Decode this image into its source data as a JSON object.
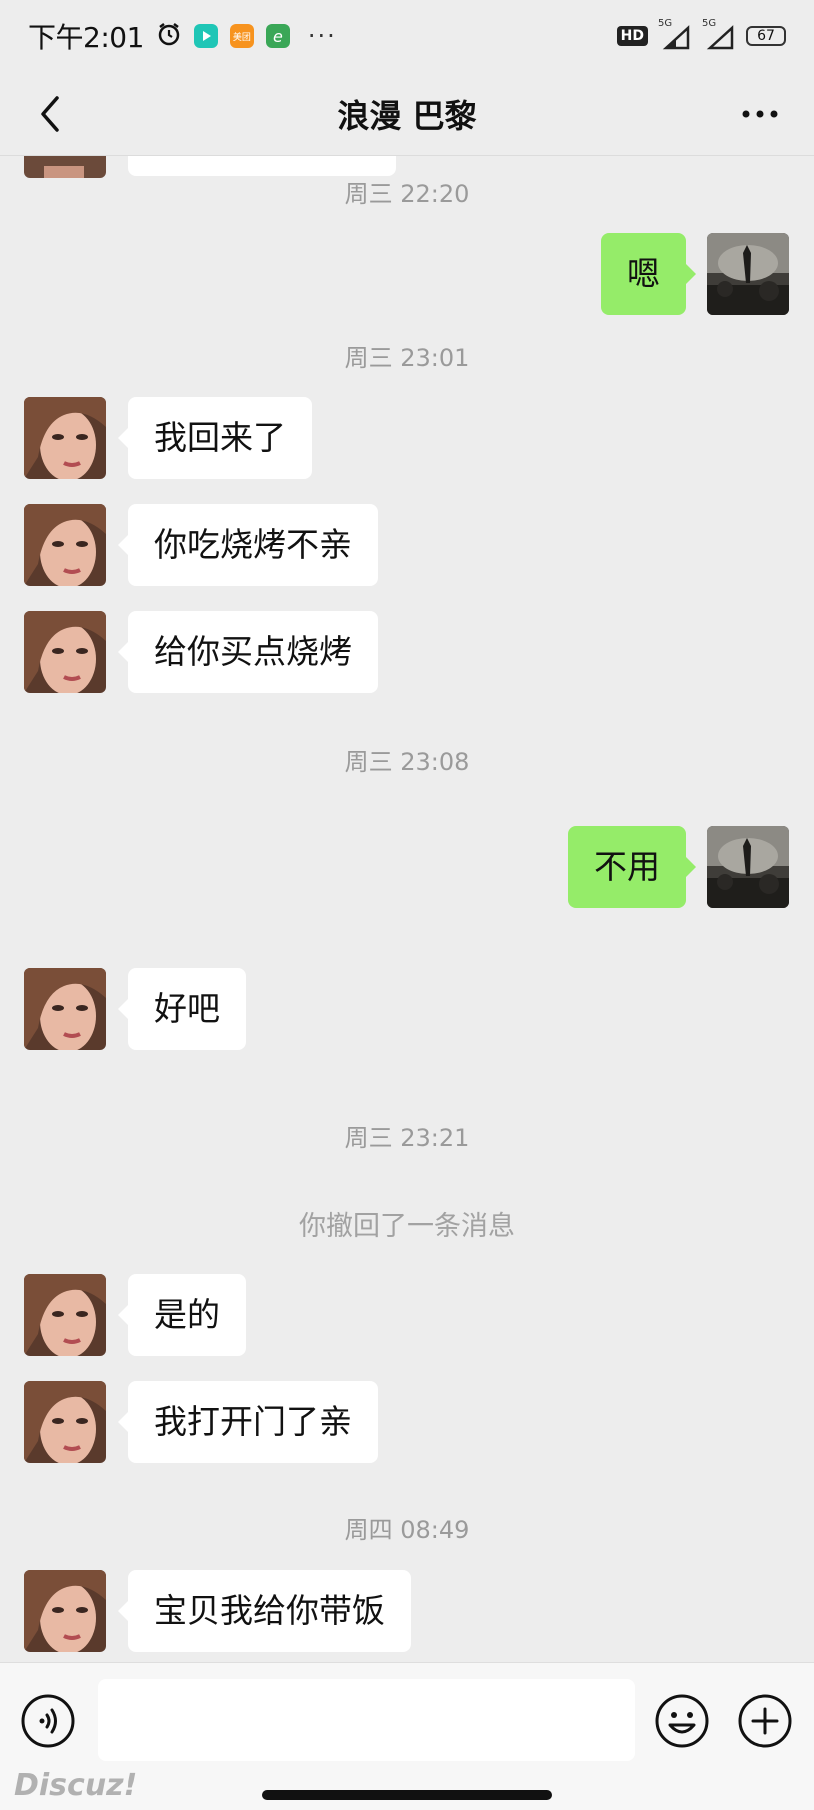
{
  "status_bar": {
    "time": "下午2:01",
    "app_icons": [
      {
        "name": "alarm-icon",
        "color": "#111111"
      },
      {
        "name": "video-app-icon",
        "color": "#1fc6b6"
      },
      {
        "name": "meituan-app-icon",
        "color": "#f7931e",
        "label": "美团"
      },
      {
        "name": "browser-app-icon",
        "color": "#3aa757",
        "label": "e"
      }
    ],
    "more": "···",
    "hd_badge": "HD",
    "network_1": "5G",
    "network_2": "5G",
    "battery": "67"
  },
  "header": {
    "title": "浪漫 巴黎"
  },
  "messages": [
    {
      "kind": "time",
      "text": "周三 22:20"
    },
    {
      "kind": "msg",
      "from": "me",
      "text": "嗯"
    },
    {
      "kind": "time",
      "text": "周三 23:01"
    },
    {
      "kind": "msg",
      "from": "her",
      "text": "我回来了"
    },
    {
      "kind": "msg",
      "from": "her",
      "text": "你吃烧烤不亲"
    },
    {
      "kind": "msg",
      "from": "her",
      "text": "给你买点烧烤"
    },
    {
      "kind": "time",
      "text": "周三 23:08"
    },
    {
      "kind": "msg",
      "from": "me",
      "text": "不用"
    },
    {
      "kind": "msg",
      "from": "her",
      "text": "好吧"
    },
    {
      "kind": "time",
      "text": "周三 23:21"
    },
    {
      "kind": "system",
      "text": "你撤回了一条消息"
    },
    {
      "kind": "msg",
      "from": "her",
      "text": "是的"
    },
    {
      "kind": "msg",
      "from": "her",
      "text": "我打开门了亲"
    },
    {
      "kind": "time",
      "text": "周四 08:49"
    },
    {
      "kind": "msg",
      "from": "her",
      "text": "宝贝我给你带饭"
    }
  ],
  "input": {
    "value": "",
    "placeholder": ""
  },
  "watermark": "Discuz!",
  "colors": {
    "background": "#ededed",
    "my_bubble": "#95ec69",
    "her_bubble": "#ffffff",
    "timestamp": "#9a9a9a"
  }
}
